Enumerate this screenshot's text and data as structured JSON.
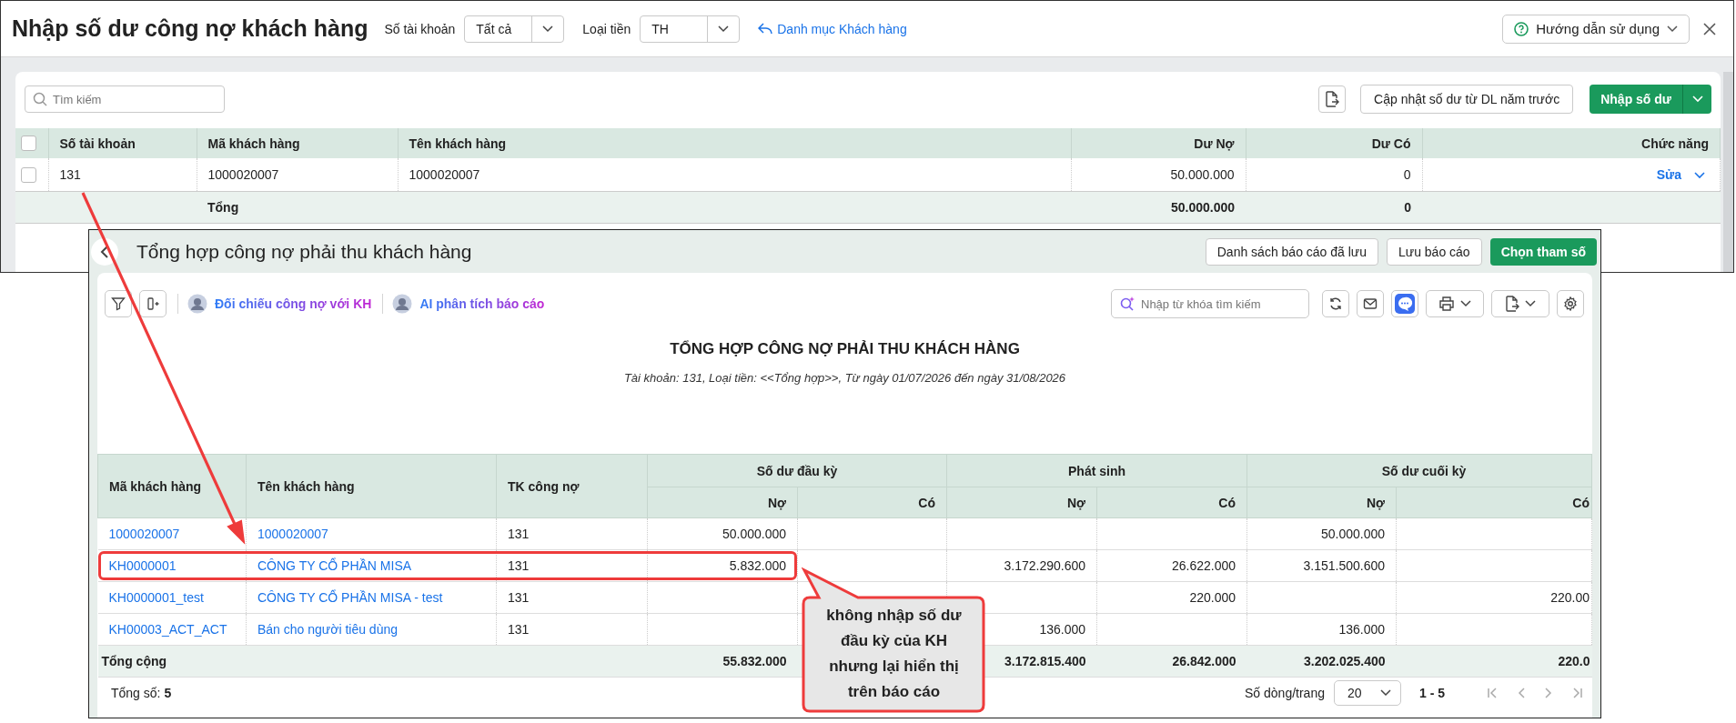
{
  "main_window": {
    "title": "Nhập số dư công nợ khách hàng",
    "filters": [
      {
        "label": "Số tài khoản",
        "value": "Tất cả"
      },
      {
        "label": "Loại tiền",
        "value": "TH"
      }
    ],
    "link": "Danh mục Khách hàng",
    "help_button": "Hướng dẫn sử dụng"
  },
  "toolbar": {
    "search": {
      "placeholder": "Tìm kiếm"
    },
    "update_button": "Cập nhật số dư từ DL năm trước",
    "primary_button": "Nhập số dư"
  },
  "table": {
    "select_all_checked": false,
    "columns": [
      "Số tài khoản",
      "Mã khách hàng",
      "Tên khách hàng",
      "Dư Nợ",
      "Dư Có",
      "Chức năng"
    ],
    "rows": [
      {
        "checked": false,
        "cells": [
          "131",
          "1000020007",
          "1000020007",
          "50.000.000",
          "0"
        ],
        "action": "Sửa"
      }
    ],
    "total": {
      "label": "Tổng",
      "values": [
        "50.000.000",
        "0"
      ]
    }
  },
  "report_window": {
    "title": "Tổng hợp công nợ phải thu khách hàng",
    "buttons": [
      {
        "label": "Danh sách báo cáo đã lưu",
        "kind": "default"
      },
      {
        "label": "Lưu báo cáo",
        "kind": "default"
      },
      {
        "label": "Chọn tham số",
        "kind": "primary"
      }
    ],
    "ai_links": [
      "Đối chiếu công nợ với KH",
      "AI phân tích báo cáo"
    ],
    "search": {
      "placeholder": "Nhập từ khóa tìm kiếm"
    },
    "heading": "TỔNG HỢP CÔNG NỢ PHẢI THU KHÁCH HÀNG",
    "subtitle": "Tài khoản: 131, Loại tiền: <<Tổng hợp>>, Từ ngày 01/07/2026 đến ngày 31/08/2026",
    "table": {
      "columns": [
        "Mã khách hàng",
        "Tên khách hàng",
        "TK công nợ"
      ],
      "column_groups": [
        {
          "label": "Số dư đầu kỳ",
          "sub_columns": [
            "Nợ",
            "Có"
          ]
        },
        {
          "label": "Phát sinh",
          "sub_columns": [
            "Nợ",
            "Có"
          ]
        },
        {
          "label": "Số dư cuối kỳ",
          "sub_columns": [
            "Nợ",
            "Có"
          ]
        }
      ],
      "rows": [
        {
          "highlighted": false,
          "cells": [
            "1000020007",
            "1000020007",
            "131",
            "50.000.000",
            null,
            null,
            null,
            "50.000.000",
            null
          ]
        },
        {
          "highlighted": true,
          "cells": [
            "KH0000001",
            "CÔNG TY CỔ PHẦN MISA",
            "131",
            "5.832.000",
            null,
            "3.172.290.600",
            "26.622.000",
            "3.151.500.600",
            null
          ]
        },
        {
          "highlighted": false,
          "cells": [
            "KH0000001_test",
            "CÔNG TY CỔ PHẦN MISA - test",
            "131",
            null,
            null,
            null,
            "220.000",
            null,
            "220.00"
          ]
        },
        {
          "highlighted": false,
          "cells": [
            "KH00003_ACT_ACT",
            "Bán cho người tiêu dùng",
            "131",
            null,
            null,
            "136.000",
            null,
            "136.000",
            null
          ]
        }
      ],
      "total": {
        "label": "Tổng cộng",
        "opening_debit": "55.832.000",
        "period_debit": "3.172.815.400",
        "period_credit": "26.842.000",
        "closing_debit": "3.202.025.400",
        "closing_credit": "220.0"
      }
    },
    "footer": {
      "count": "Tổng số: **5**",
      "page_size_label": "Số dòng/trang",
      "page_size": "20",
      "range": "1 - 5"
    }
  },
  "annotation": {
    "text": "không nhập số dư đầu kỳ của KH nhưng lại hiển thị trên báo cáo"
  }
}
